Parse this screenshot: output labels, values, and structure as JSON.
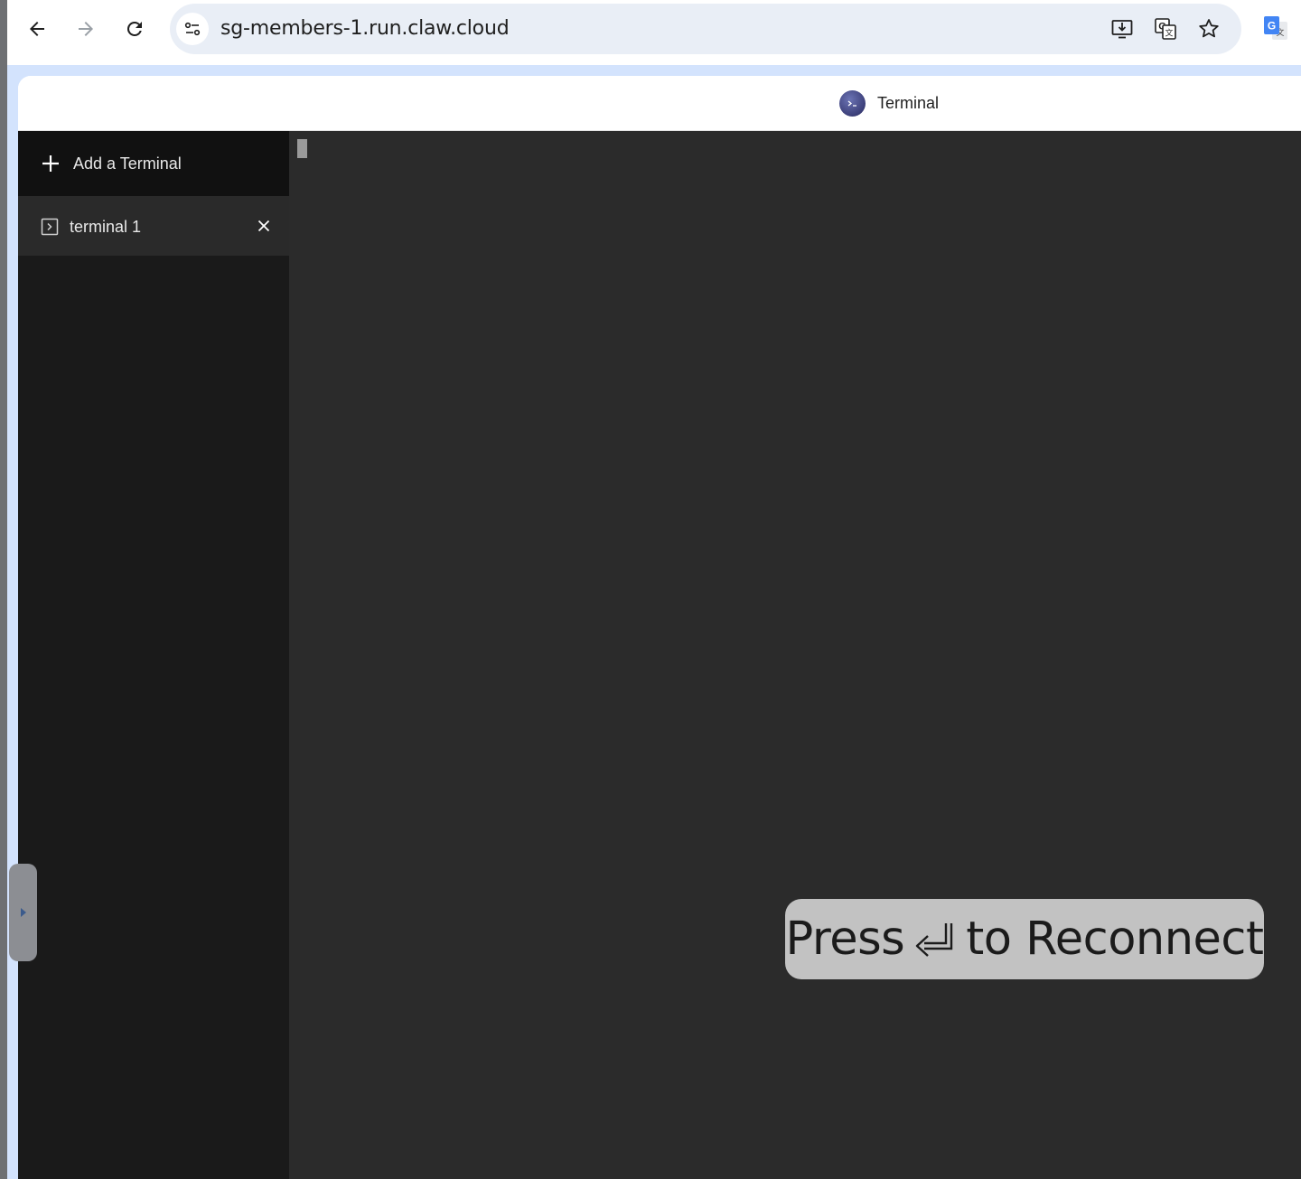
{
  "browser": {
    "url": "sg-members-1.run.claw.cloud",
    "nav": {
      "back_icon": "arrow-left-icon",
      "forward_icon": "arrow-right-icon",
      "reload_icon": "reload-icon"
    },
    "omnibox_icons": [
      "install-app-icon",
      "translate-icon",
      "bookmark-star-icon"
    ],
    "extension_icon": "google-translate-extension-icon"
  },
  "app": {
    "title": "Terminal",
    "logo_icon": "terminal-logo-icon"
  },
  "sidebar": {
    "add_label": "Add a Terminal",
    "terminals": [
      {
        "label": "terminal 1",
        "icon": "terminal-icon",
        "active": true
      }
    ]
  },
  "overlay": {
    "press": "Press",
    "icon": "enter-key-icon",
    "rest": "to Reconnect"
  },
  "colors": {
    "sidebar_bg": "#1a1a1a",
    "terminal_bg": "#2b2b2b",
    "overlay_bg": "#c2c2c2",
    "omnibox_bg": "#e9eef6"
  }
}
